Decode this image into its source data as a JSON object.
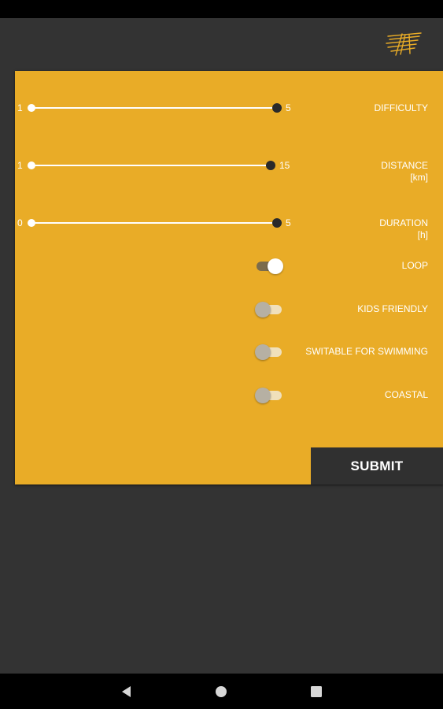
{
  "filters": {
    "sliders": [
      {
        "label": "DIFFICULTY",
        "unit": "",
        "min": "1",
        "max": "5"
      },
      {
        "label": "DISTANCE",
        "unit": "[km]",
        "min": "1",
        "max": "15"
      },
      {
        "label": "DURATION",
        "unit": "[h]",
        "min": "0",
        "max": "5"
      }
    ],
    "toggles": [
      {
        "label": "LOOP",
        "checked": true
      },
      {
        "label": "KIDS FRIENDLY",
        "checked": false
      },
      {
        "label": "SWITABLE FOR SWIMMING",
        "checked": false
      },
      {
        "label": "COASTAL",
        "checked": false
      }
    ],
    "submit_label": "SUBMIT"
  },
  "colors": {
    "panel": "#E9AC27",
    "background": "#333333",
    "button": "#303030"
  },
  "icons": {
    "logo": "app-logo-icon",
    "nav_back": "back-triangle-icon",
    "nav_home": "home-circle-icon",
    "nav_recents": "recents-square-icon"
  }
}
